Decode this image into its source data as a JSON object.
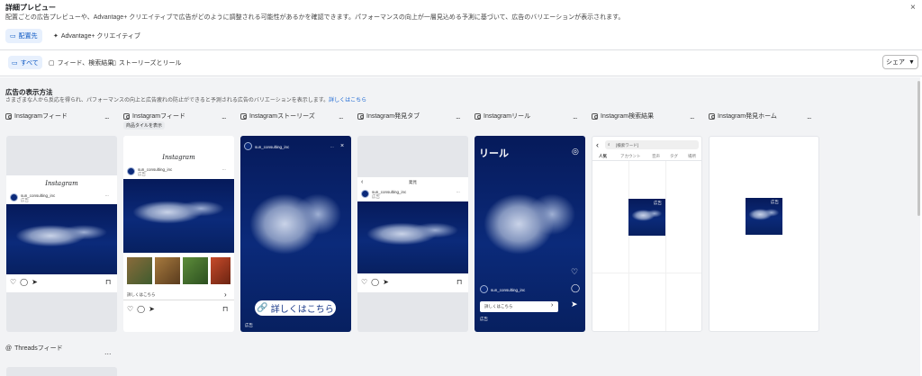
{
  "header": {
    "title": "詳細プレビュー",
    "subtitle": "配置ごとの広告プレビューや、Advantage+ クリエイティブで広告がどのように調整される可能性があるかを確認できます。パフォーマンスの向上が一層見込める予測に基づいて、広告のバリエーションが表示されます。",
    "close": "×",
    "tabs": [
      {
        "label": "配置先"
      },
      {
        "label": "Advantage+ クリエイティブ"
      }
    ]
  },
  "filters": {
    "items": [
      {
        "label": "すべて"
      },
      {
        "label": "フィード、検索結果"
      },
      {
        "label": "ストーリーズとリール"
      }
    ],
    "share_label": "シェア"
  },
  "section": {
    "title": "広告の表示方法",
    "desc": "さまざまな人から反応を得られ、パフォーマンスの向上と広告疲れの防止ができると予測される広告のバリエーションを表示します。",
    "link": "詳しくはこちら"
  },
  "columns": [
    {
      "label": "Instagramフィード"
    },
    {
      "label": "Instagramフィード",
      "badge": "商品タイルを表示"
    },
    {
      "label": "Instagramストーリーズ"
    },
    {
      "label": "Instagram発見タブ"
    },
    {
      "label": "Instagramリール"
    },
    {
      "label": "Instagram検索結果"
    },
    {
      "label": "Instagram発見ホーム"
    }
  ],
  "previews": {
    "ig_logo": "Instagram",
    "account": "sun_consulting_inc",
    "sponsored": "広告",
    "cta": "詳しくはこちら",
    "discover_header": "発見",
    "reels_title": "リール",
    "search_placeholder": "[検索ワード]",
    "search_tabs": [
      "人気",
      "アカウント",
      "音声",
      "タグ",
      "場所"
    ],
    "ad_label": "広告"
  },
  "threads": {
    "label": "Threadsフィード"
  },
  "dots": "..."
}
